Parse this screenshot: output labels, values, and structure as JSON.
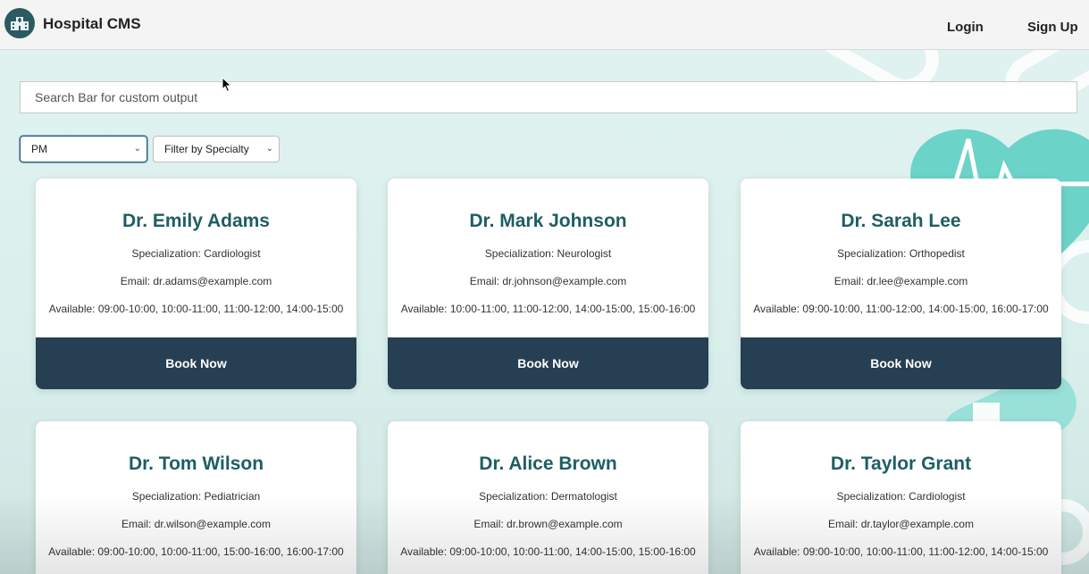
{
  "header": {
    "app_title": "Hospital CMS",
    "login_label": "Login",
    "signup_label": "Sign Up"
  },
  "search": {
    "placeholder": "Search Bar for custom output",
    "value": ""
  },
  "filters": {
    "time_selected": "PM",
    "specialty_selected": "Filter by Specialty"
  },
  "book_label": "Book Now",
  "doctors": [
    {
      "name": "Dr. Emily Adams",
      "specialization": "Specialization: Cardiologist",
      "email": "Email: dr.adams@example.com",
      "available": "Available: 09:00-10:00, 10:00-11:00, 11:00-12:00, 14:00-15:00"
    },
    {
      "name": "Dr. Mark Johnson",
      "specialization": "Specialization: Neurologist",
      "email": "Email: dr.johnson@example.com",
      "available": "Available: 10:00-11:00, 11:00-12:00, 14:00-15:00, 15:00-16:00"
    },
    {
      "name": "Dr. Sarah Lee",
      "specialization": "Specialization: Orthopedist",
      "email": "Email: dr.lee@example.com",
      "available": "Available: 09:00-10:00, 11:00-12:00, 14:00-15:00, 16:00-17:00"
    },
    {
      "name": "Dr. Tom Wilson",
      "specialization": "Specialization: Pediatrician",
      "email": "Email: dr.wilson@example.com",
      "available": "Available: 09:00-10:00, 10:00-11:00, 15:00-16:00, 16:00-17:00"
    },
    {
      "name": "Dr. Alice Brown",
      "specialization": "Specialization: Dermatologist",
      "email": "Email: dr.brown@example.com",
      "available": "Available: 09:00-10:00, 10:00-11:00, 14:00-15:00, 15:00-16:00"
    },
    {
      "name": "Dr. Taylor Grant",
      "specialization": "Specialization: Cardiologist",
      "email": "Email: dr.taylor@example.com",
      "available": "Available: 09:00-10:00, 10:00-11:00, 11:00-12:00, 14:00-15:00"
    }
  ],
  "colors": {
    "accent_dark": "#263f52",
    "doctor_name": "#1e5e63",
    "background": "#e2f3f1",
    "decoration": "#5fcfc3"
  }
}
